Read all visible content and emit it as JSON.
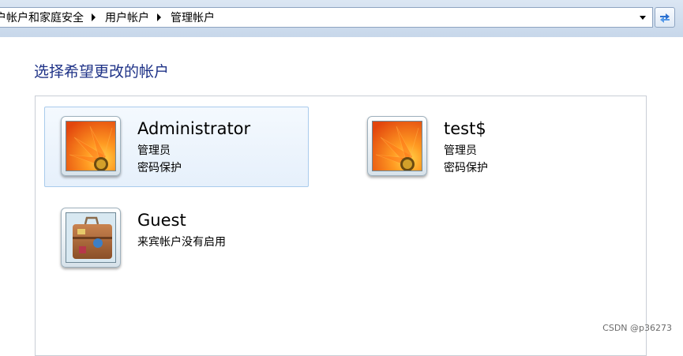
{
  "breadcrumb": {
    "items": [
      "户帐户和家庭安全",
      "用户帐户",
      "管理帐户"
    ]
  },
  "page": {
    "heading": "选择希望更改的帐户"
  },
  "accounts": [
    {
      "name": "Administrator",
      "line1": "管理员",
      "line2": "密码保护",
      "picture": "orange-flower"
    },
    {
      "name": "test$",
      "line1": "管理员",
      "line2": "密码保护",
      "picture": "orange-flower"
    },
    {
      "name": "Guest",
      "line1": "来宾帐户没有启用",
      "picture": "suitcase"
    }
  ],
  "watermark": "CSDN @p36273",
  "colors": {
    "heading": "#1e3287",
    "selected_bg": "#e6f0fb",
    "selected_border": "#a9cbec"
  },
  "icons": {
    "dropdown": "chevron-down-icon",
    "refresh": "refresh-icon",
    "breadcrumb_separator": "triangle-right-icon"
  }
}
